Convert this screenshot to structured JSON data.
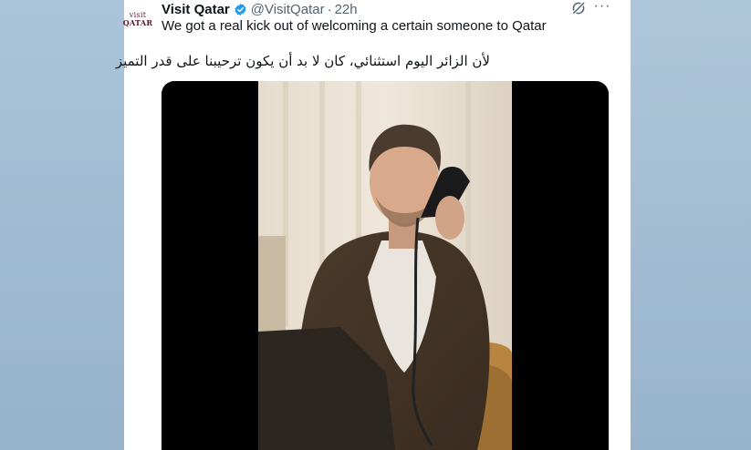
{
  "tweet": {
    "display_name": "Visit Qatar",
    "handle": "@VisitQatar",
    "separator": "·",
    "time": "22h",
    "avatar_line1": "visit",
    "avatar_line2": "QATAR",
    "text_en": "We got a real kick out of welcoming a certain someone to Qatar",
    "text_ar": "لأن الزائر اليوم استثنائي، كان لا بد أن يكون ترحيبنا على قدر التميز",
    "more": "···"
  },
  "colors": {
    "accent": "#1d9bf0",
    "text": "#0f1419",
    "muted": "#536471",
    "brand": "#5a1430"
  }
}
